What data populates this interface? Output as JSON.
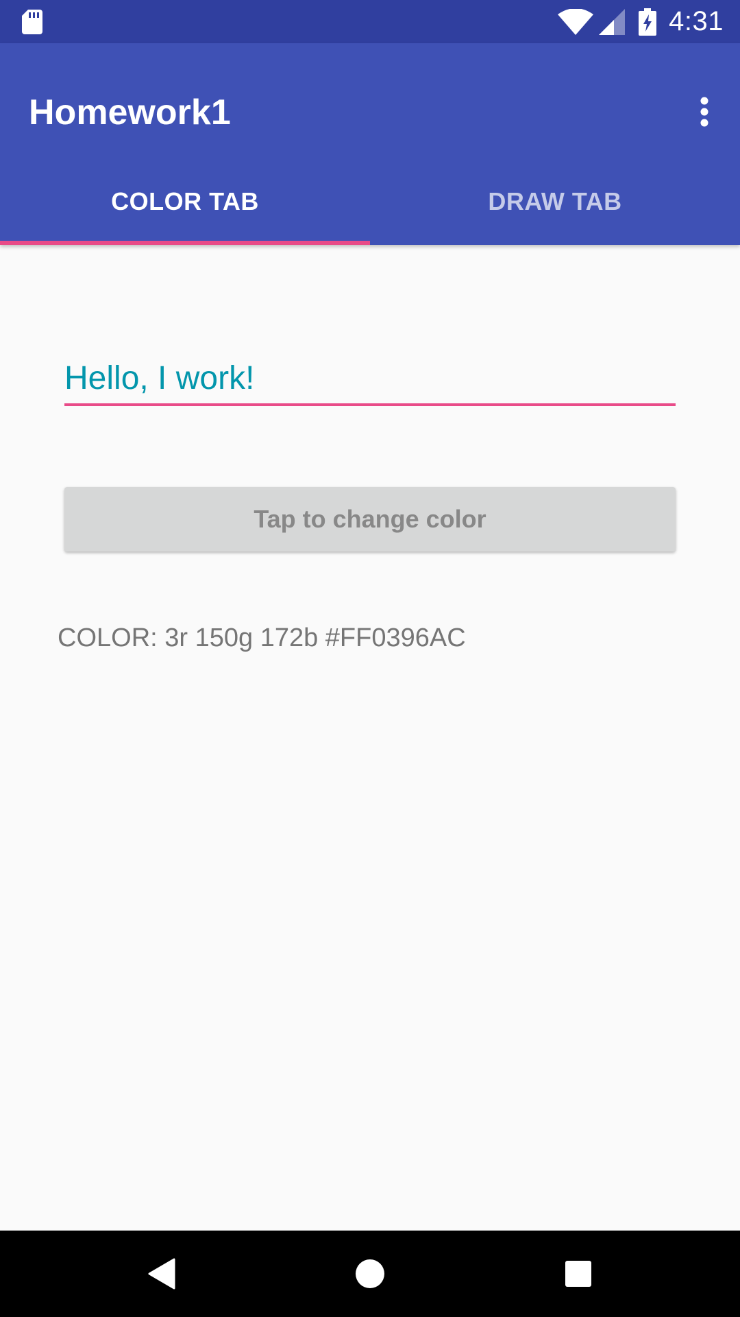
{
  "status_bar": {
    "time": "4:31",
    "icons": [
      "sd-card-icon",
      "wifi-icon",
      "signal-icon",
      "battery-charging-icon"
    ]
  },
  "app_bar": {
    "title": "Homework1",
    "overflow_icon": "more-vert-icon",
    "tabs": [
      {
        "label": "COLOR TAB",
        "selected": true
      },
      {
        "label": "DRAW TAB",
        "selected": false
      }
    ]
  },
  "content": {
    "text_field": {
      "value": "Hello, I work!",
      "color": "#0396AC"
    },
    "button_label": "Tap to change color",
    "color_readout": "COLOR: 3r 150g 172b #FF0396AC"
  },
  "nav_bar": {
    "icons": [
      "back-icon",
      "home-icon",
      "recents-icon"
    ]
  },
  "colors": {
    "status_bar": "#303F9F",
    "primary": "#3F51B5",
    "accent": "#E84B88",
    "background": "#FAFAFA"
  }
}
